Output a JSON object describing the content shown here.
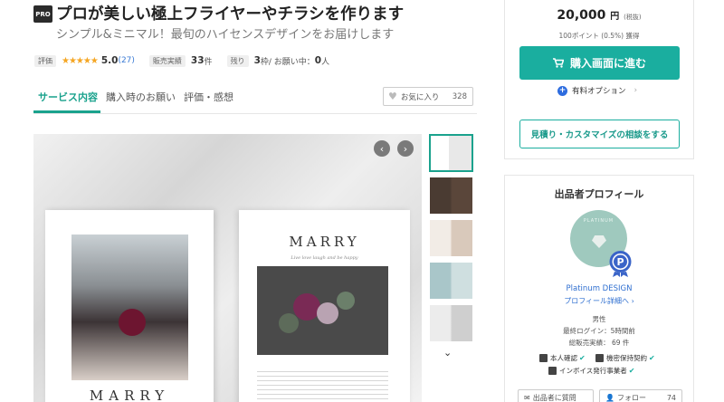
{
  "header": {
    "pro_label": "PRO",
    "title": "プロが美しい極上フライヤーやチラシを作ります",
    "subtitle": "シンプル&ミニマル！最旬のハイセンスデザインをお届けします"
  },
  "stats": {
    "rating_label": "評価",
    "stars": "★★★★★",
    "rating_value": "5.0",
    "rating_count": "(27)",
    "sales_label": "販売実績",
    "sales_count": "33",
    "sales_unit": "件",
    "remaining_label": "残り",
    "remaining_value": "3",
    "remaining_unit": "枠",
    "in_progress_label": " / お願い中：",
    "in_progress_value": "0",
    "in_progress_unit": "人"
  },
  "tabs": [
    {
      "label": "サービス内容",
      "active": true
    },
    {
      "label": "購入時のお願い",
      "active": false
    },
    {
      "label": "評価・感想",
      "active": false
    }
  ],
  "favorite": {
    "label": "お気に入り",
    "count": "328"
  },
  "gallery": {
    "prev": "‹",
    "next": "›",
    "page_left_title": "MARRY",
    "page_right_title": "MARRY",
    "page_right_script": "Live love laugh and be happy",
    "thumbs_more": "⌄"
  },
  "purchase": {
    "price": "20,000",
    "currency": "円",
    "tax_note": "(税抜)",
    "points": "100ポイント (0.5%) 獲得",
    "buy_label": "購入画面に進む",
    "option_label": "有料オプション",
    "consult_label": "見積り・カスタマイズの相談をする"
  },
  "seller": {
    "section_title": "出品者プロフィール",
    "avatar_text": "PLATINUM",
    "name": "Platinum DESIGN",
    "profile_link": "プロフィール詳細へ",
    "gender": "男性",
    "last_login": "最終ログイン：5時間前",
    "total_sales": "総販売実績： 69 件",
    "verified_identity": "本人確認",
    "nda": "機密保持契約",
    "invoice": "インボイス発行事業者",
    "message_button": "出品者に質問",
    "follow_button": "フォロー",
    "follow_count": "74"
  },
  "colors": {
    "accent": "#1aae9f",
    "link": "#2f6fd0",
    "star": "#f5a623"
  }
}
